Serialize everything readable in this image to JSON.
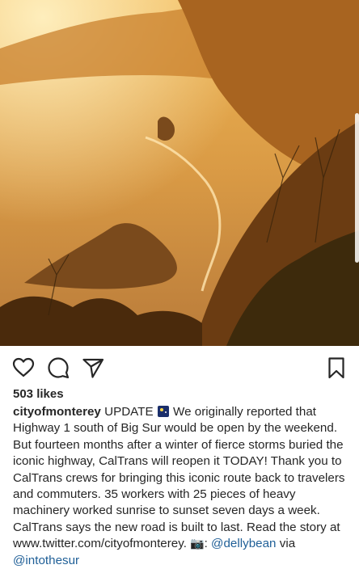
{
  "post": {
    "likes": "503 likes",
    "username": "cityofmonterey",
    "caption_part1": " UPDATE ",
    "caption_part2": " We originally reported that Highway 1 south of Big Sur would be open by the weekend. But fourteen months after a winter of fierce storms buried the iconic highway, CalTrans will reopen it TODAY! Thank you to CalTrans crews for bringing this iconic route back to travelers and commuters. 35 workers with 25 pieces of heavy machinery worked sunrise to sunset seven days a week. CalTrans says the new road is built to last. Read the story at www.twitter.com/cityofmonterey. ",
    "camera_emoji": "📷",
    "caption_part3": ": ",
    "mention1": "@dellybean",
    "caption_part4": " via ",
    "mention2": "@intothesur"
  },
  "icons": {
    "like": "heart-icon",
    "comment": "comment-icon",
    "share": "paper-plane-icon",
    "save": "bookmark-icon"
  },
  "colors": {
    "mention": "#1f5f97",
    "text": "#262626",
    "photo_warm": "#e9a53c"
  }
}
